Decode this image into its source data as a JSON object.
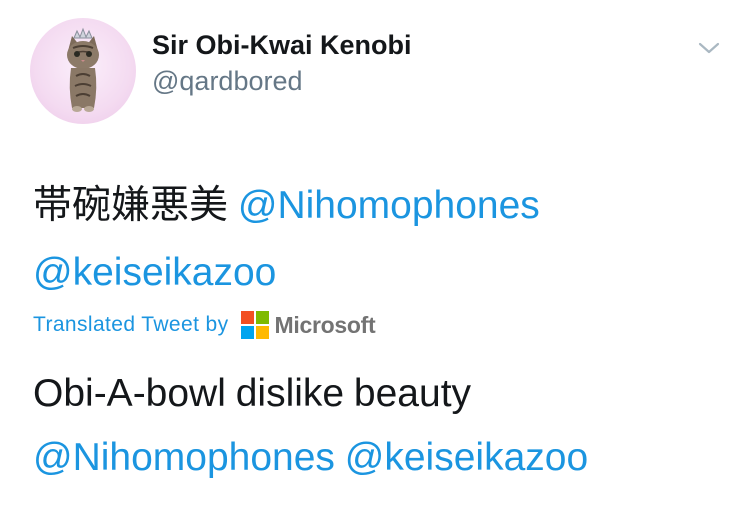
{
  "user": {
    "display_name": "Sir Obi-Kwai Kenobi",
    "handle": "@qardbored",
    "avatar_icon": "kitten-with-tiara-avatar"
  },
  "menu": {
    "icon": "chevron-down-icon"
  },
  "tweet": {
    "original_text": "帯碗嫌悪美",
    "mentions": [
      "@Nihomophones",
      "@keiseikazoo"
    ]
  },
  "translation_bar": {
    "label": "Translated Tweet by",
    "provider_name": "Microsoft",
    "provider_icon": "microsoft-logo-icon",
    "logo_colors": [
      "#f25022",
      "#7fba00",
      "#00a4ef",
      "#ffb900"
    ]
  },
  "translation": {
    "text": "Obi-A-bowl dislike beauty",
    "mentions": [
      "@Nihomophones",
      "@keiseikazoo"
    ]
  },
  "colors": {
    "link": "#1b95e0",
    "text": "#14171a",
    "secondary": "#657786"
  }
}
